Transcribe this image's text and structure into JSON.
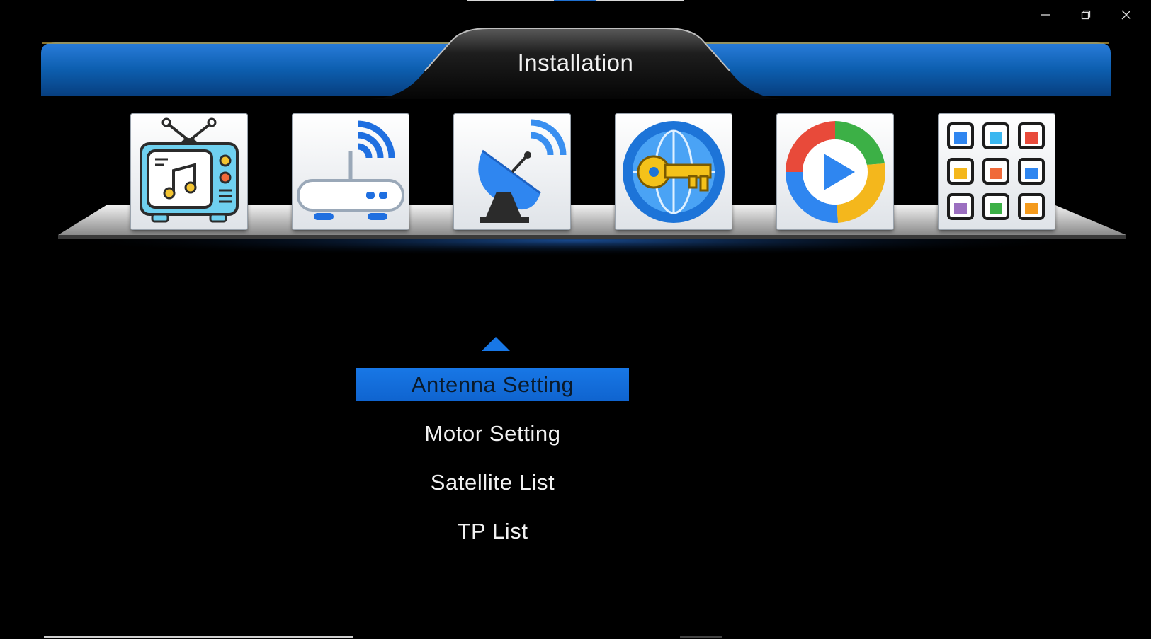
{
  "window": {
    "minimize_icon": "minimize-icon",
    "restore_icon": "restore-icon",
    "close_icon": "close-icon"
  },
  "header": {
    "title": "Installation"
  },
  "tiles": [
    {
      "name": "media-tv-icon"
    },
    {
      "name": "wifi-router-icon"
    },
    {
      "name": "satellite-dish-icon"
    },
    {
      "name": "globe-key-icon"
    },
    {
      "name": "media-player-icon"
    },
    {
      "name": "apps-grid-icon"
    }
  ],
  "menu": {
    "items": [
      {
        "label": "Antenna Setting",
        "selected": true
      },
      {
        "label": "Motor Setting",
        "selected": false
      },
      {
        "label": "Satellite List",
        "selected": false
      },
      {
        "label": "TP List",
        "selected": false
      }
    ]
  },
  "colors": {
    "accent_blue": "#1877e6",
    "header_blue": "#0d5fb0",
    "background": "#000000"
  }
}
